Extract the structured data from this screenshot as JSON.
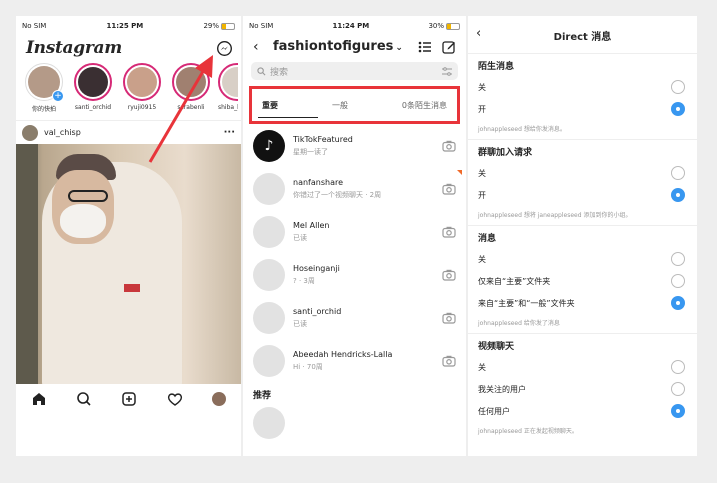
{
  "panel1": {
    "status": {
      "left": "No SIM",
      "time": "11:25 PM",
      "battery": "29%"
    },
    "logo": "Instagram",
    "stories": [
      {
        "name": "你的快拍",
        "own": true
      },
      {
        "name": "santi_orchid"
      },
      {
        "name": "ryuji0915"
      },
      {
        "name": "scrabenli"
      },
      {
        "name": "shiba_k"
      }
    ],
    "post": {
      "username": "val_chisp"
    }
  },
  "panel2": {
    "status": {
      "left": "No SIM",
      "time": "11:24 PM",
      "battery": "30%"
    },
    "title": "fashiontofigures",
    "search_placeholder": "搜索",
    "tabs": {
      "primary": "重要",
      "general": "一般",
      "requests": "0条陌生消息"
    },
    "chats": [
      {
        "name": "TikTokFeatured",
        "sub": "星期一读了",
        "avatar": "tiktok"
      },
      {
        "name": "nanfanshare",
        "sub": "你错过了一个视频聊天 · 2周",
        "dot": true
      },
      {
        "name": "Mel Allen",
        "sub": "已读"
      },
      {
        "name": "Hoseinganji",
        "sub": "? · 3周"
      },
      {
        "name": "santi_orchid",
        "sub": "已读"
      },
      {
        "name": "Abeedah Hendricks-Lalla",
        "sub": "Hi · 70周"
      }
    ],
    "recommended": "推荐"
  },
  "panel3": {
    "title": "Direct 消息",
    "sections": [
      {
        "title": "陌生消息",
        "options": [
          {
            "label": "关",
            "on": false
          },
          {
            "label": "开",
            "on": true
          }
        ],
        "note": "johnappleseed 想给你发消息。"
      },
      {
        "title": "群聊加入请求",
        "options": [
          {
            "label": "关",
            "on": false
          },
          {
            "label": "开",
            "on": true
          }
        ],
        "note": "johnappleseed 想将 janeappleseed 添加到你的小组。"
      },
      {
        "title": "消息",
        "options": [
          {
            "label": "关",
            "on": false
          },
          {
            "label": "仅来自“主要”文件夹",
            "on": false
          },
          {
            "label": "来自“主要”和“一般”文件夹",
            "on": true
          }
        ],
        "note": "johnappleseed 给你发了消息"
      },
      {
        "title": "视频聊天",
        "options": [
          {
            "label": "关",
            "on": false
          },
          {
            "label": "我关注的用户",
            "on": false
          },
          {
            "label": "任何用户",
            "on": true
          }
        ],
        "note": "johnappleseed 正在发起视频聊天。"
      }
    ]
  },
  "colors": {
    "accent": "#3897f0",
    "highlight": "#e8343a"
  }
}
